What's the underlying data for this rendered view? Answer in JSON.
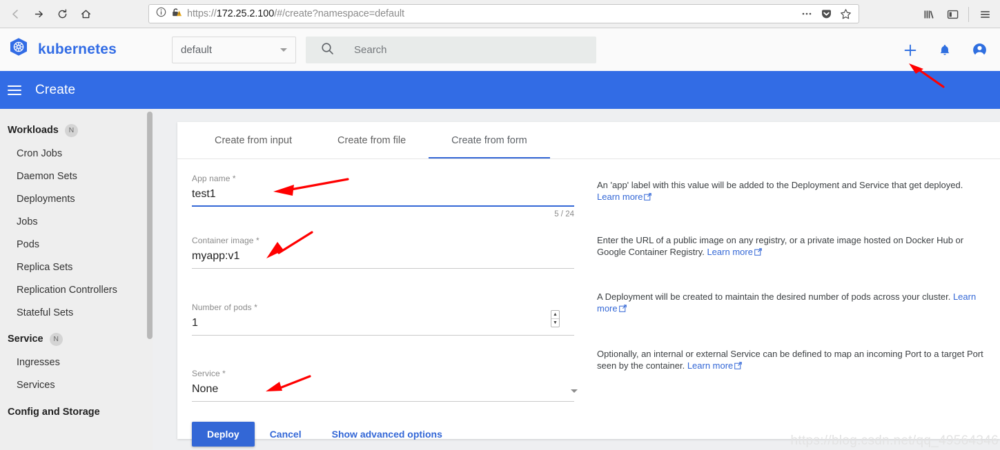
{
  "browser": {
    "url_scheme": "https://",
    "url_host": "172.25.2.100",
    "url_path": "/#/create?namespace=default",
    "nav_back": "back-icon",
    "nav_forward": "forward-icon",
    "nav_reload": "reload-icon",
    "nav_home": "home-icon",
    "icons": {
      "page_info": "info-icon",
      "insecure_lock": "broken-lock-icon",
      "more": "ellipsis-icon",
      "pocket": "pocket-icon",
      "bookmark": "star-icon",
      "library": "library-icon",
      "sidebar": "sidebar-icon",
      "menu": "hamburger-menu-icon"
    }
  },
  "topbar": {
    "brand": "kubernetes",
    "logo": "kubernetes-helm-logo",
    "namespace_value": "default",
    "search_placeholder": "Search",
    "actions": {
      "create": "plus-icon",
      "notifications": "bell-icon",
      "account": "account-circle-icon"
    }
  },
  "header": {
    "menu_icon": "hamburger-menu-icon",
    "title": "Create"
  },
  "sidebar": {
    "groups": [
      {
        "label": "Workloads",
        "badge": "N",
        "items": [
          "Cron Jobs",
          "Daemon Sets",
          "Deployments",
          "Jobs",
          "Pods",
          "Replica Sets",
          "Replication Controllers",
          "Stateful Sets"
        ]
      },
      {
        "label": "Service",
        "badge": "N",
        "items": [
          "Ingresses",
          "Services"
        ]
      },
      {
        "label": "Config and Storage",
        "badge": "",
        "items": []
      }
    ]
  },
  "main": {
    "tabs": [
      {
        "label": "Create from input",
        "active": false
      },
      {
        "label": "Create from file",
        "active": false
      },
      {
        "label": "Create from form",
        "active": true
      }
    ],
    "fields": [
      {
        "label": "App name *",
        "value": "test1",
        "counter": "5 / 24",
        "focused": true
      },
      {
        "label": "Container image *",
        "value": "myapp:v1",
        "counter": "",
        "focused": false
      },
      {
        "label": "Number of pods *",
        "value": "1",
        "counter": "",
        "focused": false
      },
      {
        "label": "Service *",
        "value": "None",
        "counter": "",
        "focused": false
      }
    ],
    "help": [
      {
        "text": "An 'app' label with this value will be added to the Deployment and Service that get deployed. ",
        "link": "Learn more"
      },
      {
        "text": "Enter the URL of a public image on any registry, or a private image hosted on Docker Hub or Google Container Registry. ",
        "link": "Learn more"
      },
      {
        "text": "A Deployment will be created to maintain the desired number of pods across your cluster. ",
        "link": "Learn more"
      },
      {
        "text": "Optionally, an internal or external Service can be defined to map an incoming Port to a target Port seen by the container. ",
        "link": "Learn more"
      }
    ],
    "actions": {
      "deploy": "Deploy",
      "cancel": "Cancel",
      "advanced": "Show advanced options"
    }
  },
  "watermark": "https://blog.csdn.net/qq_49564346",
  "colors": {
    "k8s_blue": "#326ce5",
    "accent_blue": "#3367d6",
    "annotation_red": "#ff0000",
    "sidebar_bg": "#eeeeee",
    "content_bg": "#eeeff1"
  }
}
